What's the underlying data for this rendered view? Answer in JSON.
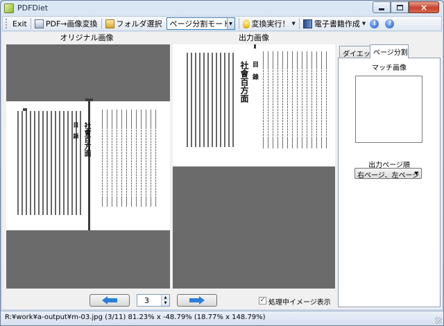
{
  "window": {
    "title": "PDFDiet"
  },
  "toolbar": {
    "exit_label": "Exit",
    "pdf_to_image_label": "PDF→画像変換",
    "folder_select_label": "フォルダ選択",
    "mode_value": "ページ分割モード",
    "execute_label": "変換実行！",
    "ebook_label": "電子書籍作成"
  },
  "panes": {
    "original_label": "オリジナル画像",
    "output_label": "出力画像"
  },
  "tabs": [
    {
      "label": "ダイエット",
      "active": false
    },
    {
      "label": "ページ分割",
      "active": true
    }
  ],
  "page_split": {
    "match_image_label": "マッチ画像",
    "output_order_label": "出力ページ順",
    "output_order_value": "右ページ、左ページ"
  },
  "navigation": {
    "page_number": "3",
    "show_processing_label": "処理中イメージ表示",
    "show_processing_checked": true
  },
  "page_image": {
    "book_title": "社會百方面",
    "toc_heading": "目　錄"
  },
  "status": {
    "text": "R:¥work¥a-output¥m-03.jpg (3/11)  81.23% x -48.79% (18.77% x 148.79%)"
  },
  "colors": {
    "pane_background": "#6b6b6b",
    "nav_arrow": "#2a7fd8",
    "title_gradient_top": "#dbe7f5"
  }
}
